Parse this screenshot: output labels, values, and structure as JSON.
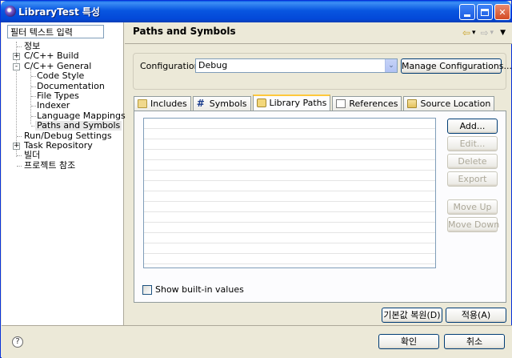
{
  "window": {
    "title": "LibraryTest 특성"
  },
  "filter": {
    "placeholder": "필터 텍스트 입력"
  },
  "tree": [
    {
      "label": "정보",
      "expander": ""
    },
    {
      "label": "C/C++ Build",
      "expander": "+"
    },
    {
      "label": "C/C++ General",
      "expander": "-"
    },
    {
      "label": "Code Style",
      "expander": ""
    },
    {
      "label": "Documentation",
      "expander": ""
    },
    {
      "label": "File Types",
      "expander": ""
    },
    {
      "label": "Indexer",
      "expander": ""
    },
    {
      "label": "Language Mappings",
      "expander": ""
    },
    {
      "label": "Paths and Symbols",
      "expander": ""
    },
    {
      "label": "Run/Debug Settings",
      "expander": ""
    },
    {
      "label": "Task Repository",
      "expander": "+"
    },
    {
      "label": "빌더",
      "expander": ""
    },
    {
      "label": "프로젝트 참조",
      "expander": ""
    }
  ],
  "page": {
    "title": "Paths and Symbols"
  },
  "nav": {
    "back": "⇦",
    "back_menu": "▾",
    "forward": "⇨",
    "forward_menu": "▾",
    "view_menu": "▼"
  },
  "config": {
    "label": "Configuration:",
    "value": "Debug",
    "arrow": "⌄",
    "manage_label": "Manage Configurations..."
  },
  "tabs": [
    {
      "label": "Includes"
    },
    {
      "label": "Symbols"
    },
    {
      "label": "Library Paths"
    },
    {
      "label": "References"
    },
    {
      "label": "Source Location"
    }
  ],
  "side_buttons": {
    "add": "Add...",
    "edit": "Edit...",
    "delete": "Delete",
    "export": "Export",
    "move_up": "Move Up",
    "move_down": "Move Down"
  },
  "show_builtin": {
    "label": "Show built-in values"
  },
  "bottom_buttons": {
    "restore_defaults": "기본값 복원(D)",
    "apply": "적용(A)"
  },
  "footer": {
    "help_icon": "?",
    "ok": "확인",
    "cancel": "취소"
  },
  "colors": {
    "titlebar": "#0a5ae6",
    "dialog_bg": "#ece9d8",
    "tab_highlight": "#ffc83c"
  }
}
